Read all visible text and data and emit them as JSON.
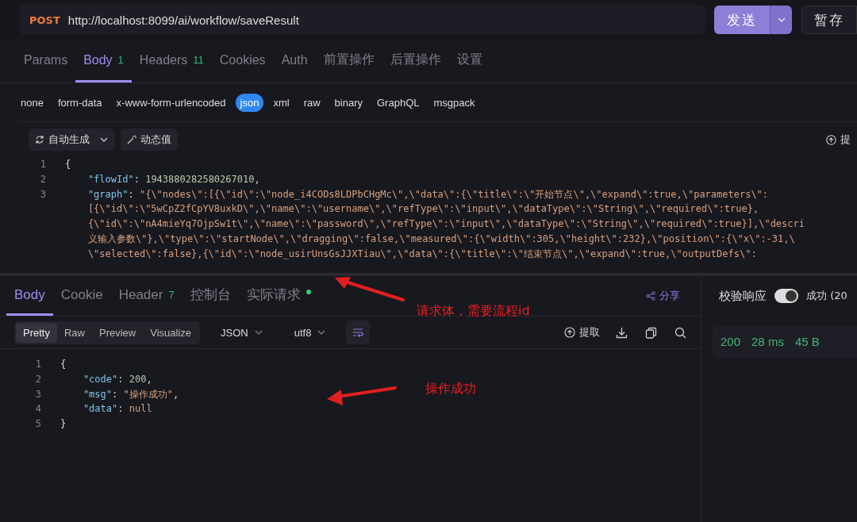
{
  "request": {
    "method": "POST",
    "url": "http://localhost:8099/ai/workflow/saveResult",
    "send_label": "发送",
    "save_label": "暂存"
  },
  "request_tabs": [
    {
      "label": "Params",
      "selected": false
    },
    {
      "label": "Body",
      "badge": "1",
      "selected": true
    },
    {
      "label": "Headers",
      "badge": "11",
      "selected": false
    },
    {
      "label": "Cookies",
      "selected": false
    },
    {
      "label": "Auth",
      "selected": false
    },
    {
      "label": "前置操作",
      "selected": false
    },
    {
      "label": "后置操作",
      "selected": false
    },
    {
      "label": "设置",
      "selected": false
    }
  ],
  "body_types": [
    {
      "label": "none",
      "selected": false
    },
    {
      "label": "form-data",
      "selected": false
    },
    {
      "label": "x-www-form-urlencoded",
      "selected": false
    },
    {
      "label": "json",
      "selected": true
    },
    {
      "label": "xml",
      "selected": false
    },
    {
      "label": "raw",
      "selected": false
    },
    {
      "label": "binary",
      "selected": false
    },
    {
      "label": "GraphQL",
      "selected": false
    },
    {
      "label": "msgpack",
      "selected": false
    }
  ],
  "body_toolbar": {
    "auto_generate": "自动生成",
    "dynamic_value": "动态值",
    "extract": "提"
  },
  "request_code": [
    {
      "number": "1",
      "tokens": [
        {
          "kind": "punct",
          "text": "{"
        }
      ]
    },
    {
      "number": "2",
      "tokens": [
        {
          "kind": "key",
          "text": "    \"flowId\""
        },
        {
          "kind": "punct",
          "text": ": "
        },
        {
          "kind": "number",
          "text": "1943880282580267010"
        },
        {
          "kind": "punct",
          "text": ","
        }
      ]
    },
    {
      "number": "3",
      "tokens": [
        {
          "kind": "key",
          "text": "    \"graph\""
        },
        {
          "kind": "punct",
          "text": ": "
        },
        {
          "kind": "string",
          "text": "\"{\\\"nodes\\\":[{\\\"id\\\":\\\"node_i4CODs8LDPbCHgMc\\\",\\\"data\\\":{\\\"title\\\":\\\"开始节点\\\",\\\"expand\\\":true,\\\"parameters\\\":"
        }
      ],
      "wrapped": [
        "    [{\\\"id\\\":\\\"5wCpZ2fCpYV8uxkD\\\",\\\"name\\\":\\\"username\\\",\\\"refType\\\":\\\"input\\\",\\\"dataType\\\":\\\"String\\\",\\\"required\\\":true},",
        "    {\\\"id\\\":\\\"nA4mieYq7OjpSw1t\\\",\\\"name\\\":\\\"password\\\",\\\"refType\\\":\\\"input\\\",\\\"dataType\\\":\\\"String\\\",\\\"required\\\":true}],\\\"descri",
        "    义输入参数\\\"},\\\"type\\\":\\\"startNode\\\",\\\"dragging\\\":false,\\\"measured\\\":{\\\"width\\\":305,\\\"height\\\":232},\\\"position\\\":{\\\"x\\\":-31,\\",
        "    \\\"selected\\\":false},{\\\"id\\\":\\\"node_usirUnsGsJJXTiau\\\",\\\"data\\\":{\\\"title\\\":\\\"结束节点\\\",\\\"expand\\\":true,\\\"outputDefs\\\":"
      ]
    }
  ],
  "response_tabs": [
    {
      "label": "Body",
      "selected": true
    },
    {
      "label": "Cookie",
      "selected": false
    },
    {
      "label": "Header",
      "badge": "7",
      "selected": false
    },
    {
      "label": "控制台",
      "selected": false
    },
    {
      "label": "实际请求",
      "dot": true,
      "selected": false
    }
  ],
  "share_label": "分享",
  "view_modes": [
    {
      "label": "Pretty",
      "selected": true
    },
    {
      "label": "Raw",
      "selected": false
    },
    {
      "label": "Preview",
      "selected": false
    },
    {
      "label": "Visualize",
      "selected": false
    }
  ],
  "format_select": "JSON",
  "encoding_select": "utf8",
  "extract_label": "提取",
  "response_code": [
    {
      "number": "1",
      "tokens": [
        {
          "kind": "punct",
          "text": "{"
        }
      ]
    },
    {
      "number": "2",
      "tokens": [
        {
          "kind": "key",
          "text": "    \"code\""
        },
        {
          "kind": "punct",
          "text": ": "
        },
        {
          "kind": "number",
          "text": "200"
        },
        {
          "kind": "punct",
          "text": ","
        }
      ]
    },
    {
      "number": "3",
      "tokens": [
        {
          "kind": "key",
          "text": "    \"msg\""
        },
        {
          "kind": "punct",
          "text": ": "
        },
        {
          "kind": "string",
          "text": "\"操作成功\""
        },
        {
          "kind": "punct",
          "text": ","
        }
      ]
    },
    {
      "number": "4",
      "tokens": [
        {
          "kind": "key",
          "text": "    \"data\""
        },
        {
          "kind": "punct",
          "text": ": "
        },
        {
          "kind": "null",
          "text": "null"
        }
      ]
    },
    {
      "number": "5",
      "tokens": [
        {
          "kind": "punct",
          "text": "}"
        }
      ]
    }
  ],
  "validation": {
    "label": "校验响应",
    "on": true,
    "result": "成功 (20"
  },
  "response_stats": {
    "status": "200",
    "time": "28 ms",
    "size": "45 B"
  },
  "annotations": [
    {
      "text": "请求体，需要流程id"
    },
    {
      "text": "操作成功"
    }
  ]
}
